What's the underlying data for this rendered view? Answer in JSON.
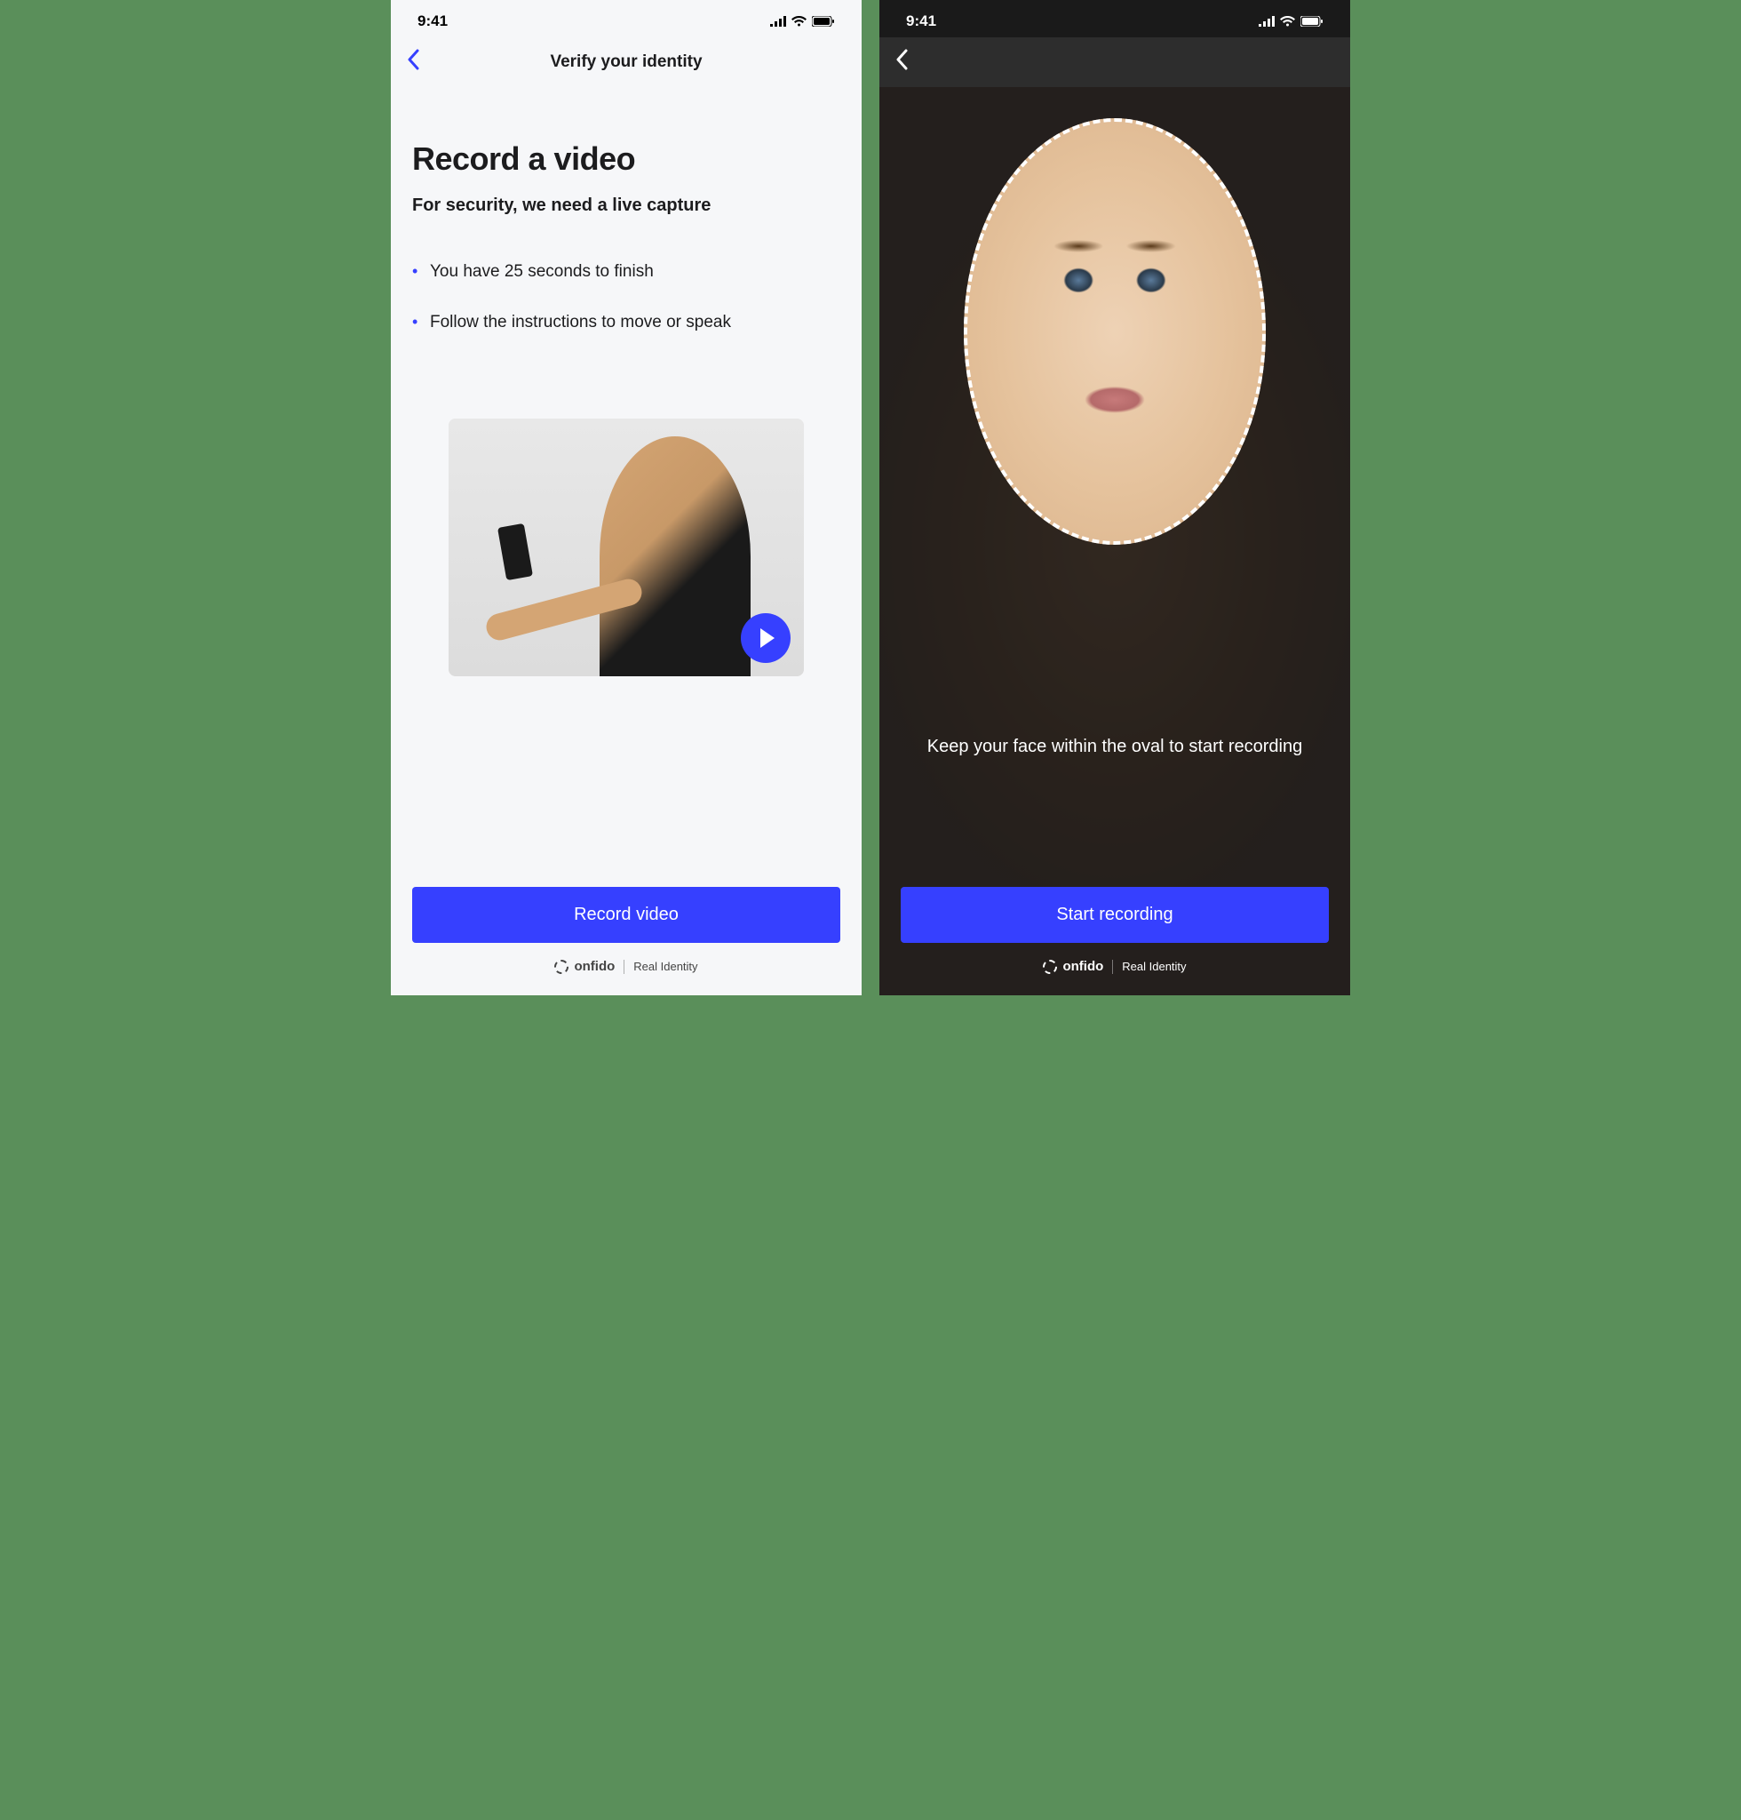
{
  "status": {
    "time": "9:41"
  },
  "left": {
    "nav_title": "Verify your identity",
    "heading": "Record a video",
    "subheading": "For security, we need a live capture",
    "bullets": [
      "You have 25 seconds to finish",
      "Follow the instructions to move or speak"
    ],
    "cta": "Record video"
  },
  "right": {
    "instruction": "Keep your face within the oval to start recording",
    "cta": "Start recording"
  },
  "brand": {
    "name": "onfido",
    "tagline": "Real Identity"
  },
  "colors": {
    "accent": "#3640ff"
  }
}
